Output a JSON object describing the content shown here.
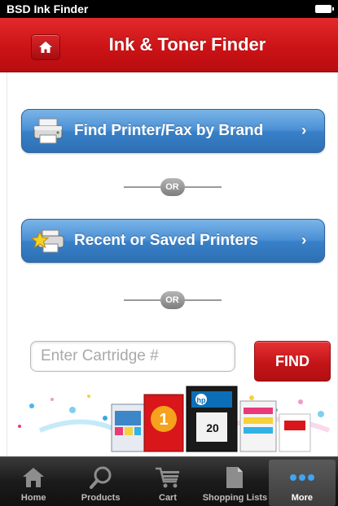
{
  "statusbar": {
    "app_name": "BSD Ink Finder"
  },
  "header": {
    "title": "Ink & Toner Finder",
    "home_icon": "home-icon"
  },
  "main": {
    "find_by_brand_label": "Find Printer/Fax by Brand",
    "or_label_1": "OR",
    "recent_saved_label": "Recent or Saved Printers",
    "or_label_2": "OR",
    "cartridge_placeholder": "Enter Cartridge #",
    "find_button_label": "FIND",
    "banner_cartridge_number": "20"
  },
  "tabbar": {
    "tabs": [
      {
        "label": "Home",
        "icon": "house-icon"
      },
      {
        "label": "Products",
        "icon": "magnifier-icon"
      },
      {
        "label": "Cart",
        "icon": "cart-icon"
      },
      {
        "label": "Shopping Lists",
        "icon": "document-icon"
      },
      {
        "label": "More",
        "icon": "more-dots-icon",
        "active": true
      }
    ]
  },
  "colors": {
    "brand_red": "#cc1316",
    "button_blue": "#4a8fd4",
    "tabbar_dark": "#1b1b1b"
  }
}
